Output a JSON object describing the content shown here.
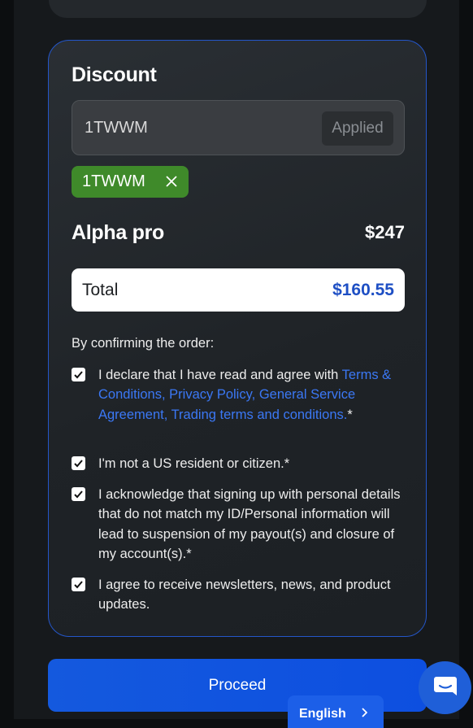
{
  "discount": {
    "title": "Discount",
    "code_input_value": "1TWWM",
    "applied_label": "Applied",
    "chip_code": "1TWWM"
  },
  "product": {
    "name": "Alpha pro",
    "price": "$247"
  },
  "total": {
    "label": "Total",
    "value": "$160.55"
  },
  "confirmation": {
    "heading": "By confirming the order:",
    "items": [
      {
        "text_before": "I declare that I have read and agree with ",
        "link_terms": "Terms & Conditions,",
        "link_privacy": "Privacy Policy,",
        "link_general": "General Service Agreement,",
        "link_trading": "Trading terms and conditions.",
        "suffix": "*",
        "checked": true
      },
      {
        "text": "I'm not a US resident or citizen.*",
        "checked": true
      },
      {
        "text": "I acknowledge that signing up with personal details that do not match my ID/Personal information will lead to suspension of my payout(s) and closure of my account(s).*",
        "checked": true
      },
      {
        "text": "I agree to receive newsletters, news, and product updates.",
        "checked": true
      }
    ]
  },
  "actions": {
    "proceed_label": "Proceed",
    "language_label": "English"
  },
  "icons": {
    "chip_remove": "close-icon",
    "checkbox": "checkmark-icon",
    "language_chevron": "chevron-right-icon",
    "chat": "chat-bubble-icon"
  },
  "colors": {
    "accent_blue": "#1c5fe8",
    "link_blue": "#3b78f5",
    "chip_green": "#3f8a2a",
    "total_value_blue": "#1e4fc4"
  }
}
